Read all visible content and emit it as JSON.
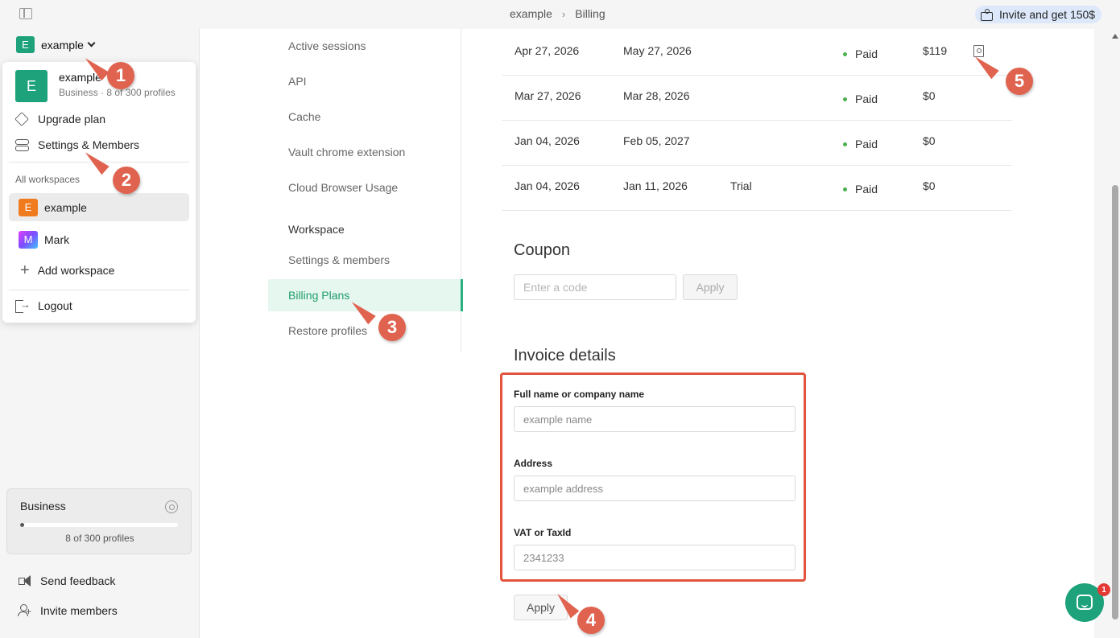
{
  "topbar": {
    "breadcrumb": [
      "example",
      "Billing"
    ],
    "invite_label": "Invite and get 150$"
  },
  "sidebar": {
    "workspace_letter": "E",
    "workspace_name": "example",
    "plan_card": {
      "title": "Business",
      "usage_fraction": 0.027,
      "count_label": "8 of 300 profiles"
    },
    "send_feedback": "Send feedback",
    "invite_members": "Invite members"
  },
  "dropdown": {
    "current": {
      "letter": "E",
      "name": "example",
      "subtitle": "Business · 8 of 300 profiles"
    },
    "upgrade_plan": "Upgrade plan",
    "settings_members": "Settings & Members",
    "section_label": "All workspaces",
    "workspaces": [
      {
        "letter": "E",
        "name": "example"
      },
      {
        "letter": "M",
        "name": "Mark"
      }
    ],
    "add_workspace": "Add workspace",
    "logout": "Logout"
  },
  "settings_nav": {
    "items": [
      "Active sessions",
      "API",
      "Cache",
      "Vault chrome extension",
      "Cloud Browser Usage"
    ],
    "workspace_heading": "Workspace",
    "workspace_items": [
      "Settings & members",
      "Billing Plans",
      "Restore profiles"
    ]
  },
  "invoices": [
    {
      "start": "Apr 27, 2026",
      "end": "May 27, 2026",
      "type": "",
      "status": "Paid",
      "amount": "$119"
    },
    {
      "start": "Mar 27, 2026",
      "end": "Mar 28, 2026",
      "type": "",
      "status": "Paid",
      "amount": "$0"
    },
    {
      "start": "Jan 04, 2026",
      "end": "Feb 05, 2027",
      "type": "",
      "status": "Paid",
      "amount": "$0"
    },
    {
      "start": "Jan 04, 2026",
      "end": "Jan 11, 2026",
      "type": "Trial",
      "status": "Paid",
      "amount": "$0"
    }
  ],
  "coupon": {
    "title": "Coupon",
    "placeholder": "Enter a code",
    "apply": "Apply"
  },
  "invoice_details": {
    "title": "Invoice details",
    "name_label": "Full name or company name",
    "name_placeholder": "example name",
    "address_label": "Address",
    "address_placeholder": "example address",
    "vat_label": "VAT or TaxId",
    "vat_placeholder": "2341233",
    "apply": "Apply"
  },
  "chat": {
    "badge": "1"
  },
  "callouts": [
    "1",
    "2",
    "3",
    "4",
    "5"
  ],
  "colors": {
    "accent": "#1ea27b",
    "highlight": "#e2533c",
    "paid": "#4caf50"
  }
}
